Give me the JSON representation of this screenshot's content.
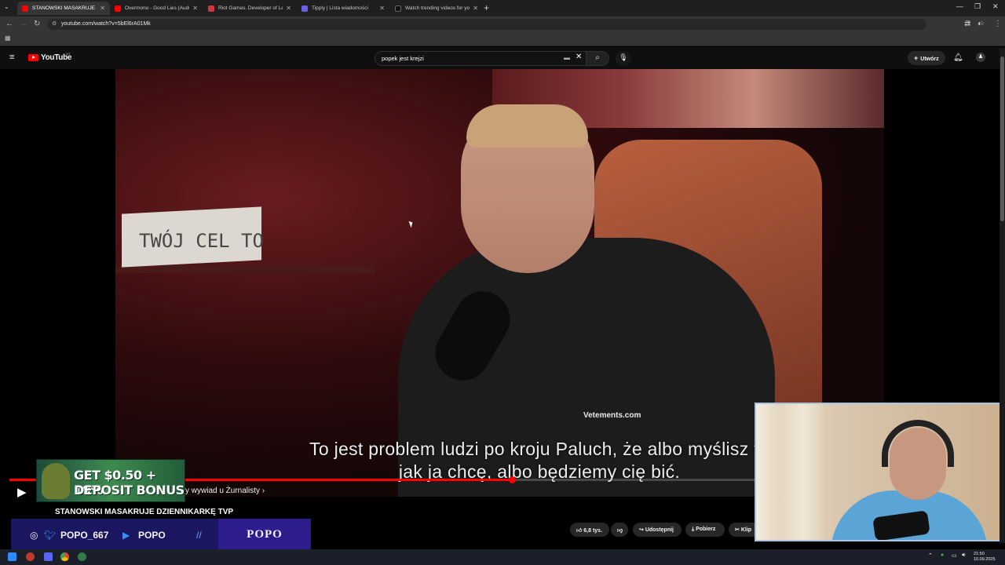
{
  "browser": {
    "tabs": [
      {
        "label": "STANOWSKI MASAKRUJE DZIE",
        "color": "#ff0000",
        "active": true
      },
      {
        "label": "Overmono - Good Lies (Audio)",
        "color": "#ff0000",
        "active": false
      },
      {
        "label": "Riot Games. Developer of Leag",
        "color": "#d13639",
        "active": false
      },
      {
        "label": "Tipply | Lista wiadomości",
        "color": "#6c5ce7",
        "active": false
      },
      {
        "label": "Watch trending videos for you",
        "color": "#111111",
        "active": false
      }
    ],
    "new_tab": "+",
    "url": "youtube.com/watch?v=5bEl6rA01Mk"
  },
  "youtube": {
    "logo_text": "YouTube",
    "country_code": "MT",
    "search_value": "popek jest krejzi",
    "create_label": "Utwórz"
  },
  "video": {
    "sign_text": "TWÓJ CEL TO",
    "shirt_text": "Vetements.com",
    "subtitle_line1": "To jest problem ludzi po kroju Paluch, że albo myślisz ta",
    "subtitle_line2": "jak ja chcę, albo będziemy cię bić.",
    "progress": 0.64,
    "chapter": "y wywiad u Żurnalisty ›"
  },
  "ad": {
    "line1": "GET $0.50 + 10%",
    "line2": "DEPOSIT BONUS"
  },
  "overlay": {
    "title": "STANOWSKI MASAKRUJE DZIENNIKARKĘ TVP",
    "handle1": "POPO_667",
    "handle2": "POPO",
    "right_label": "POPO"
  },
  "actions": {
    "likes": "6,8 tys.",
    "share": "Udostępnij",
    "download": "Pobierz",
    "clip": "Klip"
  },
  "taskbar": {
    "time": "21:50",
    "date": "10.09.2025"
  }
}
